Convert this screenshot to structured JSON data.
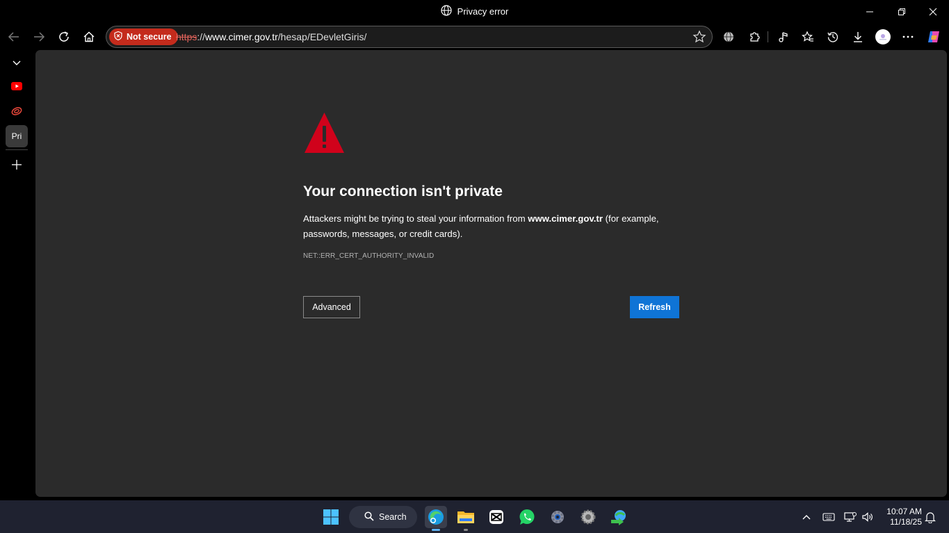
{
  "window": {
    "title": "Privacy error"
  },
  "toolbar": {
    "security_badge": "Not secure",
    "url_scheme": "https",
    "url_sep": "://",
    "url_host": "www.cimer.gov.tr",
    "url_path": "/hesap/EDevletGiris/"
  },
  "sidebar": {
    "active_tab_label": "Pri"
  },
  "error_page": {
    "heading": "Your connection isn't private",
    "desc_before": "Attackers might be trying to steal your information from ",
    "desc_host": "www.cimer.gov.tr",
    "desc_after": " (for example, passwords, messages, or credit cards).",
    "error_code": "NET::ERR_CERT_AUTHORITY_INVALID",
    "advanced_label": "Advanced",
    "refresh_label": "Refresh"
  },
  "taskbar": {
    "search_label": "Search",
    "time": "10:07 AM",
    "date": "11/18/25"
  },
  "colors": {
    "not_secure_bg": "#c42b1c",
    "warning_red": "#d0021b",
    "refresh_blue": "#0f74d6",
    "content_bg": "#2b2b2b"
  }
}
